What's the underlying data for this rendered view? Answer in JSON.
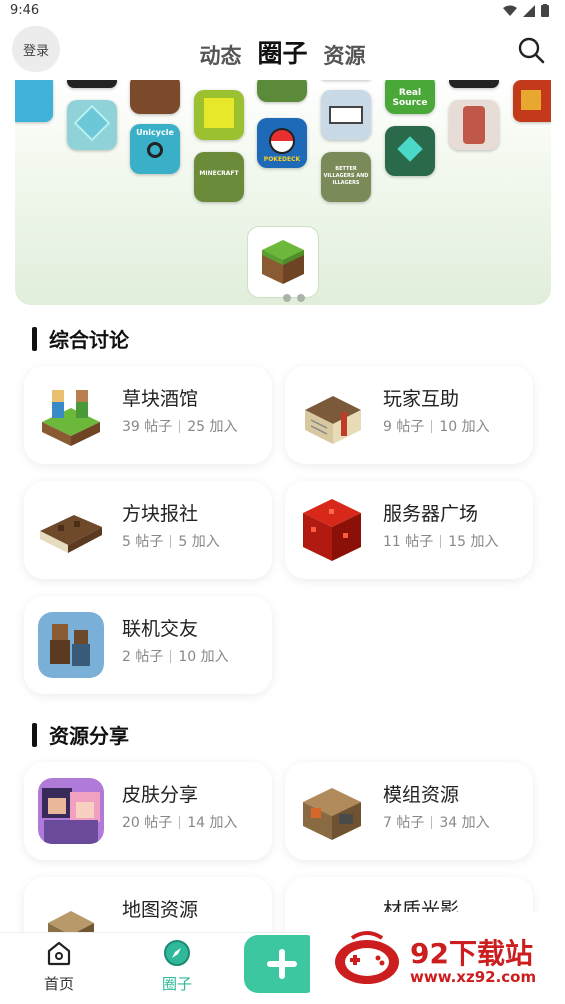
{
  "status_bar": {
    "time": "9:46"
  },
  "header": {
    "login_label": "登录",
    "tabs": [
      {
        "label": "动态"
      },
      {
        "label": "圈子"
      },
      {
        "label": "资源"
      }
    ],
    "active_tab": "圈子"
  },
  "banner": {
    "tile_texts": {
      "real_source": "Real Source",
      "unicycle": "Unicycle",
      "minecraft": "MINECRAFT",
      "villagers": "BETTER VILLAGERS AND ILLAGERS",
      "pokedeck": "POKEDECK"
    },
    "page_count": 2,
    "active_page": 1
  },
  "sections": [
    {
      "title": "综合讨论",
      "cards": [
        {
          "name": "草块酒馆",
          "posts": "39 帖子",
          "members": "25 加入",
          "icon": "grass-tavern-icon"
        },
        {
          "name": "玩家互助",
          "posts": "9 帖子",
          "members": "10 加入",
          "icon": "book-icon"
        },
        {
          "name": "方块报社",
          "posts": "5 帖子",
          "members": "5 加入",
          "icon": "newspaper-block-icon"
        },
        {
          "name": "服务器广场",
          "posts": "11 帖子",
          "members": "15 加入",
          "icon": "redstone-block-icon"
        },
        {
          "name": "联机交友",
          "posts": "2 帖子",
          "members": "10 加入",
          "icon": "players-icon"
        }
      ]
    },
    {
      "title": "资源分享",
      "cards": [
        {
          "name": "皮肤分享",
          "posts": "20 帖子",
          "members": "14 加入",
          "icon": "skin-icon"
        },
        {
          "name": "模组资源",
          "posts": "7 帖子",
          "members": "34 加入",
          "icon": "mod-icon"
        },
        {
          "name": "地图资源",
          "posts": "",
          "members": "",
          "icon": "map-icon"
        },
        {
          "name": "材质光影",
          "posts": "",
          "members": "",
          "icon": "texture-icon"
        }
      ]
    }
  ],
  "bottom_nav": {
    "items": [
      {
        "label": "首页",
        "icon": "home-icon"
      },
      {
        "label": "圈子",
        "icon": "compass-icon"
      }
    ],
    "add_icon": "plus-icon"
  },
  "watermark": {
    "brand": "92下载站",
    "url": "www.xz92.com"
  },
  "colors": {
    "accent": "#3cc7a0",
    "active_nav": "#2fb89a",
    "watermark": "#cc1e1e"
  }
}
